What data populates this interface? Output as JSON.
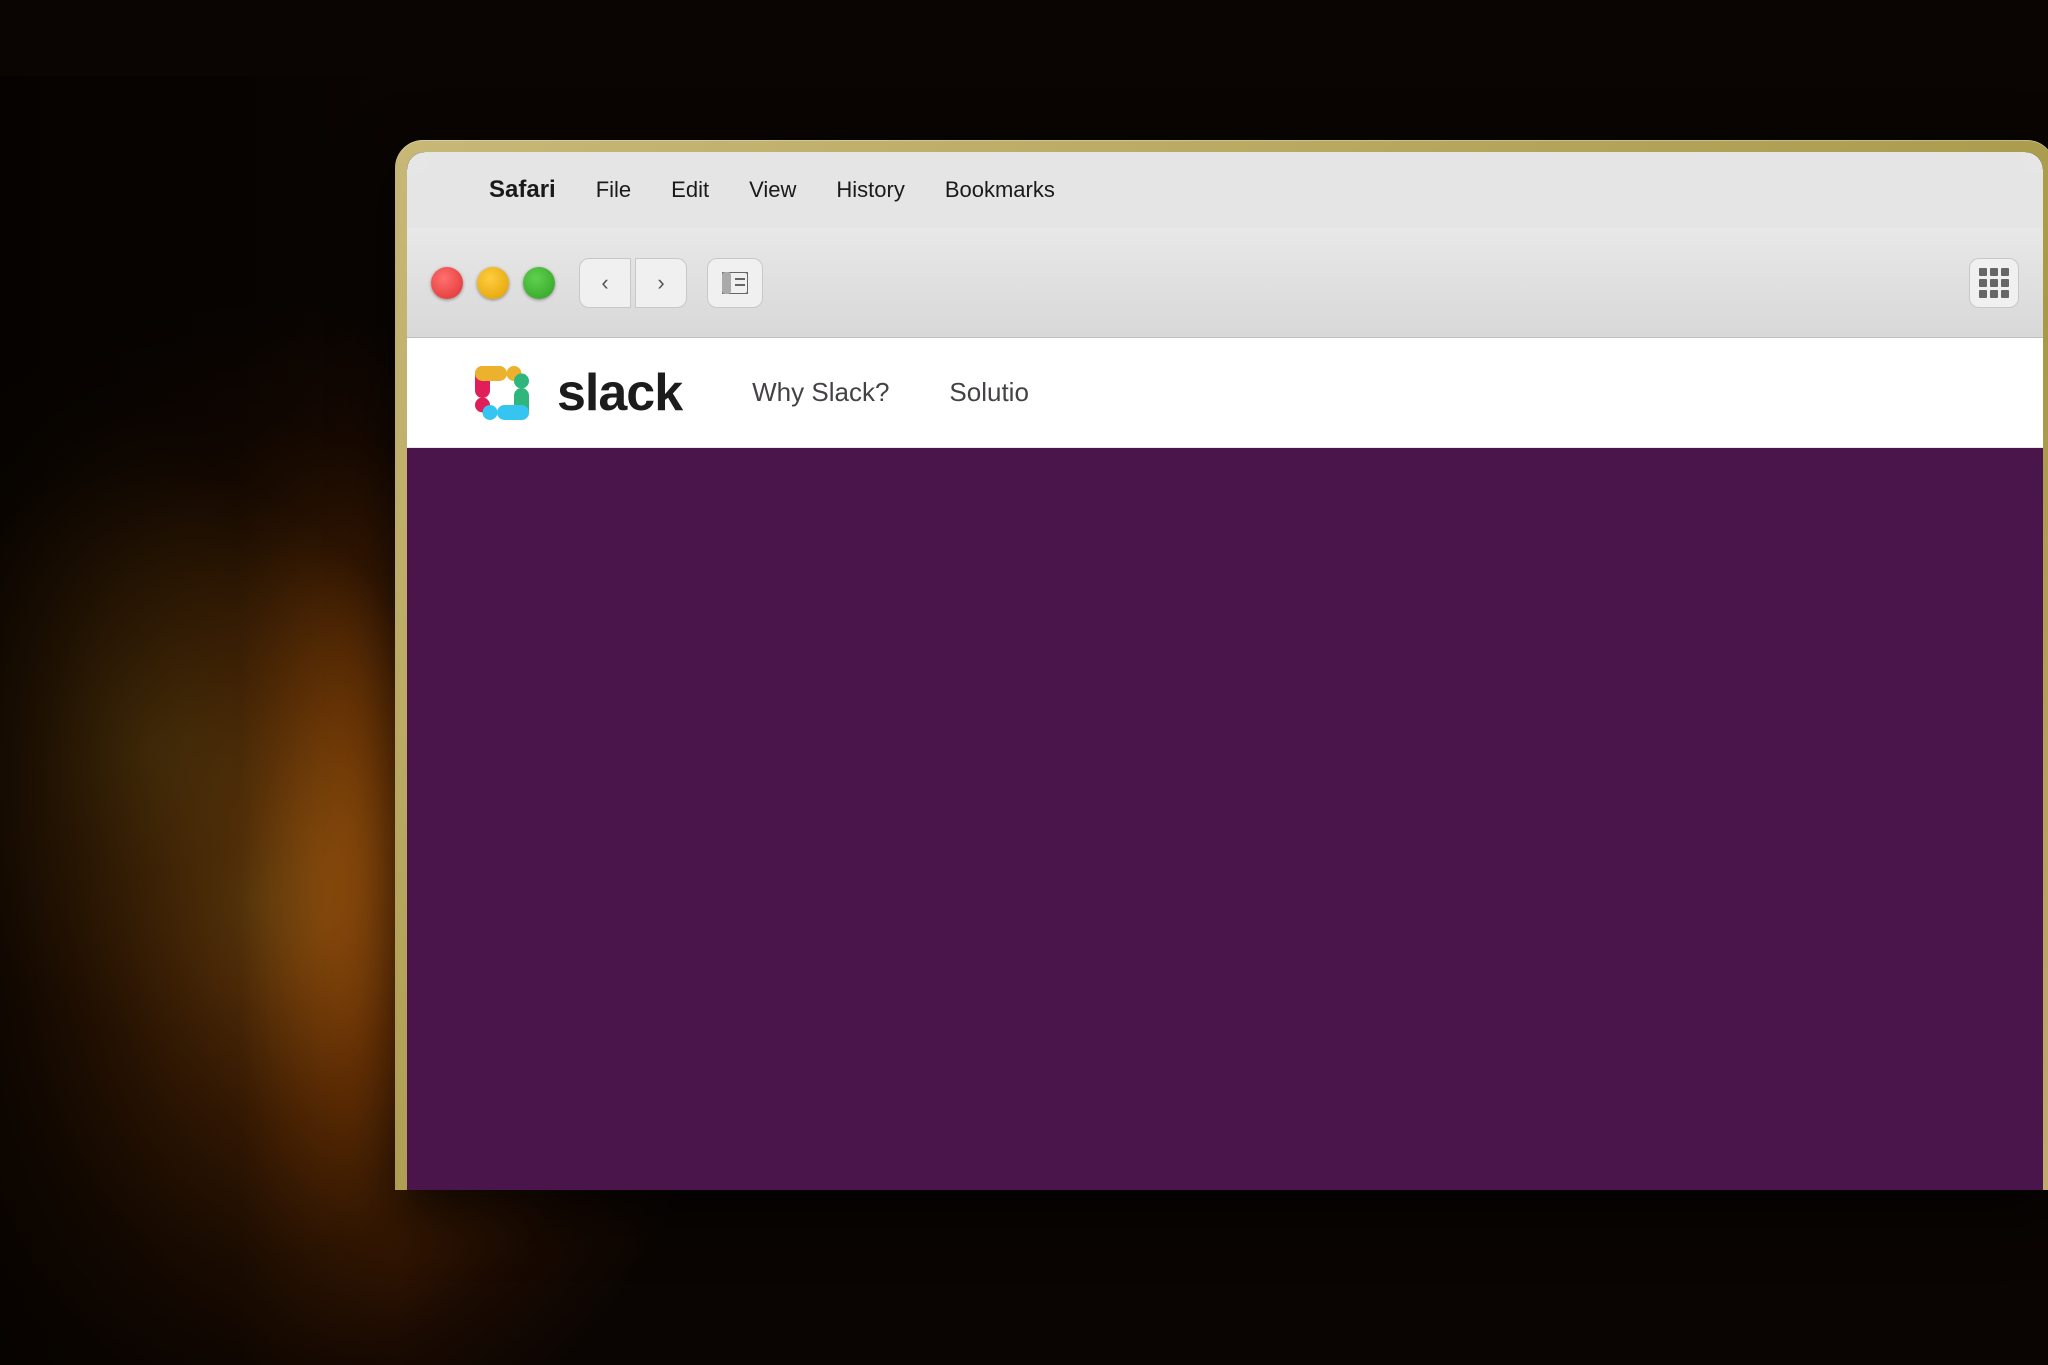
{
  "background": {
    "color": "#1a1008"
  },
  "macos": {
    "menubar": {
      "apple_symbol": "",
      "items": [
        {
          "label": "Safari",
          "bold": true
        },
        {
          "label": "File"
        },
        {
          "label": "Edit"
        },
        {
          "label": "View"
        },
        {
          "label": "History"
        },
        {
          "label": "Bookmarks"
        }
      ]
    }
  },
  "browser": {
    "nav": {
      "back_icon": "‹",
      "forward_icon": "›",
      "sidebar_icon": "⊞"
    },
    "traffic_lights": {
      "close_label": "close",
      "minimize_label": "minimize",
      "maximize_label": "maximize"
    }
  },
  "slack_website": {
    "logo_text": "slack",
    "nav_items": [
      {
        "label": "Why Slack?"
      },
      {
        "label": "Solutio"
      }
    ],
    "hero_bg_color": "#4a154b"
  }
}
